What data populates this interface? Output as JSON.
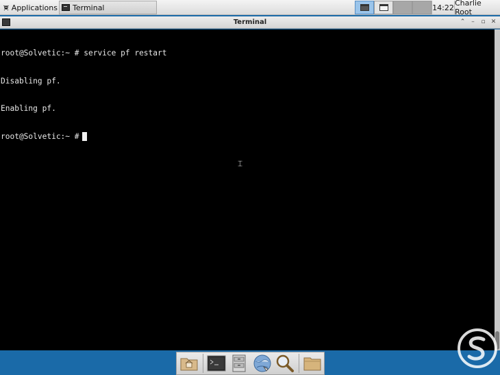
{
  "top_panel": {
    "applications_label": "Applications",
    "task_label": "Terminal",
    "clock": "14:22",
    "user": "Charlie Root"
  },
  "window": {
    "title": "Terminal"
  },
  "terminal": {
    "lines": [
      "root@Solvetic:~ # service pf restart",
      "Disabling pf.",
      "Enabling pf.",
      "root@Solvetic:~ #"
    ]
  },
  "dock": {
    "items": [
      "home-folder-icon",
      "terminal-icon",
      "file-manager-icon",
      "web-browser-icon",
      "search-icon",
      "folder-icon"
    ]
  },
  "colors": {
    "terminal_bg": "#000000",
    "terminal_fg": "#e8e8e8",
    "desktop_bg": "#1a6aa8",
    "active_workspace": "#9ac4ea"
  }
}
